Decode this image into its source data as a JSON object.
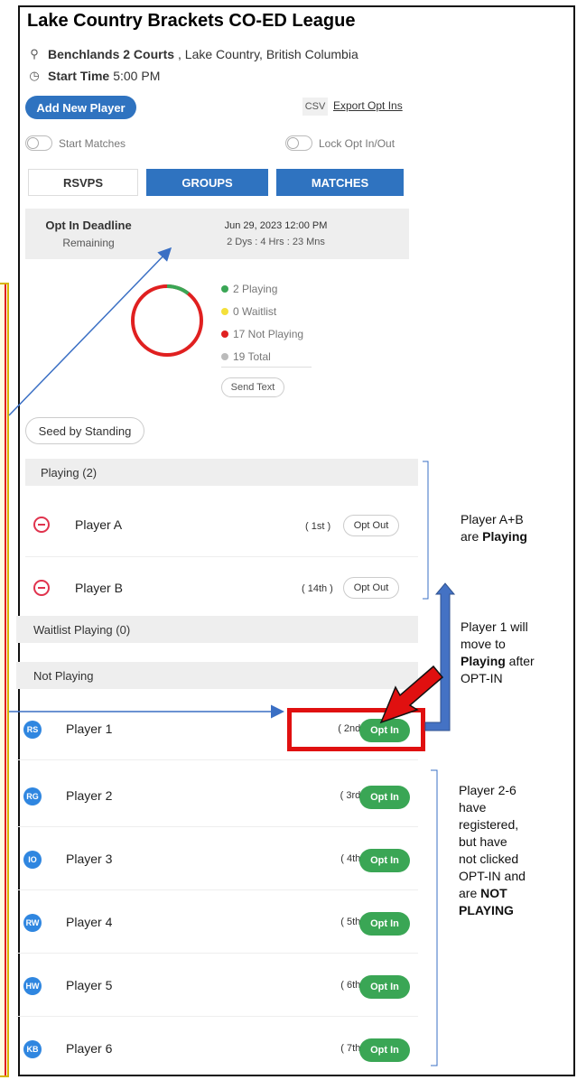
{
  "header": {
    "title": "Lake Country Brackets CO-ED League",
    "location_name": "Benchlands 2 Courts",
    "location_rest": ", Lake Country, British Columbia",
    "start_label": "Start Time",
    "start_value": "5:00 PM"
  },
  "toolbar": {
    "add_player": "Add New Player",
    "csv": "CSV",
    "export": "Export Opt Ins",
    "start_matches": "Start Matches",
    "lock_opt": "Lock Opt In/Out"
  },
  "tabs": [
    "RSVPS",
    "GROUPS",
    "MATCHES"
  ],
  "deadline": {
    "label": "Opt In Deadline",
    "sub": "Remaining",
    "date": "Jun 29, 2023 12:00 PM",
    "remaining": "2 Dys : 4 Hrs : 23 Mns"
  },
  "summary": {
    "playing": 2,
    "waitlist": 0,
    "not_playing": 17,
    "total": 19,
    "labels": [
      "2 Playing",
      "0 Waitlist",
      "17 Not Playing",
      "19 Total"
    ],
    "colors": {
      "playing": "#3aa655",
      "waitlist": "#f4e03a",
      "not_playing": "#e02020",
      "total": "#bbbbbb"
    },
    "send_text": "Send Text"
  },
  "seed_button": "Seed by Standing",
  "sections": {
    "playing": "Playing (2)",
    "waitlist": "Waitlist Playing (0)",
    "not_playing": "Not Playing"
  },
  "playing_players": [
    {
      "name": "Player A",
      "rank": "( 1st )",
      "action": "Opt Out"
    },
    {
      "name": "Player B",
      "rank": "( 14th )",
      "action": "Opt Out"
    }
  ],
  "not_playing_players": [
    {
      "initials": "RS",
      "name": "Player 1",
      "rank": "( 2nd )",
      "action": "Opt In"
    },
    {
      "initials": "RG",
      "name": "Player 2",
      "rank": "( 3rd )",
      "action": "Opt In"
    },
    {
      "initials": "IO",
      "name": "Player 3",
      "rank": "( 4th )",
      "action": "Opt In"
    },
    {
      "initials": "RW",
      "name": "Player 4",
      "rank": "( 5th )",
      "action": "Opt In"
    },
    {
      "initials": "HW",
      "name": "Player 5",
      "rank": "( 6th )",
      "action": "Opt In"
    },
    {
      "initials": "KB",
      "name": "Player 6",
      "rank": "( 7th )",
      "action": "Opt In"
    }
  ],
  "annotations": {
    "ab_line1": "Player A+B",
    "ab_line2": "are ",
    "ab_bold": "Playing",
    "p1_lines": [
      "Player 1 will",
      "move to"
    ],
    "p1_bold": "Playing",
    "p1_rest": " after",
    "p1_last": "OPT-IN",
    "p26_lines": [
      "Player 2-6",
      "have",
      "registered,",
      "but have",
      "not clicked",
      "OPT-IN and"
    ],
    "p26_are": "are ",
    "p26_bold1": "NOT",
    "p26_bold2": "PLAYING"
  }
}
